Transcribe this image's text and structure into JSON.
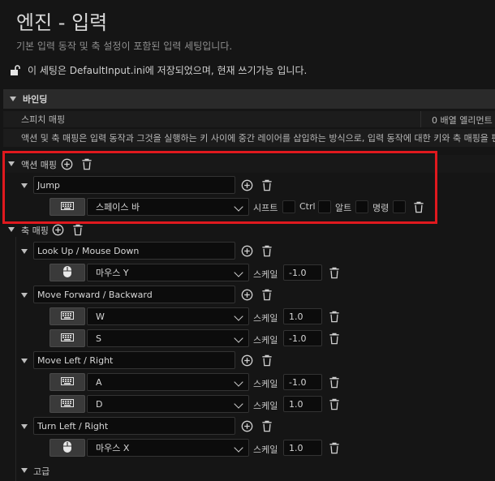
{
  "header": {
    "title": "엔진 - 입력",
    "subtitle": "기본 입력 동작 및 축 설정이 포함된 입력 세팅입니다.",
    "lock_text": "이 세팅은 DefaultInput.ini에 저장되었으며, 현재 쓰기가능 입니다."
  },
  "bindings": {
    "section_title": "바인딩",
    "speech_label": "스피치 매핑",
    "speech_value": "0 배열 엘리먼트",
    "description": "액션 및 축 매핑은 입력 동작과 그것을 실행하는 키 사이에 중간 레이어를 삽입하는 방식으로, 입력 동작에 대한 키와 축 매핑을 편하게"
  },
  "action_mappings": {
    "label": "액션 매핑",
    "items": [
      {
        "name": "Jump",
        "key": "스페이스 바",
        "key_icon": "keyboard-icon",
        "modifiers": [
          "시프트",
          "Ctrl",
          "알트",
          "명령"
        ]
      }
    ]
  },
  "axis_mappings": {
    "label": "축 매핑",
    "scale_label": "스케일",
    "groups": [
      {
        "name": "Look Up / Mouse Down",
        "keys": [
          {
            "key": "마우스 Y",
            "icon": "mouse-icon",
            "scale": "-1.0"
          }
        ]
      },
      {
        "name": "Move Forward / Backward",
        "keys": [
          {
            "key": "W",
            "icon": "keyboard-icon",
            "scale": "1.0"
          },
          {
            "key": "S",
            "icon": "keyboard-icon",
            "scale": "-1.0"
          }
        ]
      },
      {
        "name": "Move Left / Right",
        "keys": [
          {
            "key": "A",
            "icon": "keyboard-icon",
            "scale": "-1.0"
          },
          {
            "key": "D",
            "icon": "keyboard-icon",
            "scale": "1.0"
          }
        ]
      },
      {
        "name": "Turn Left / Right",
        "keys": [
          {
            "key": "마우스 X",
            "icon": "mouse-icon",
            "scale": "1.0"
          }
        ]
      }
    ]
  },
  "advanced": {
    "label": "고급"
  },
  "colors": {
    "background": "#151515",
    "highlight": "#e0191e"
  }
}
